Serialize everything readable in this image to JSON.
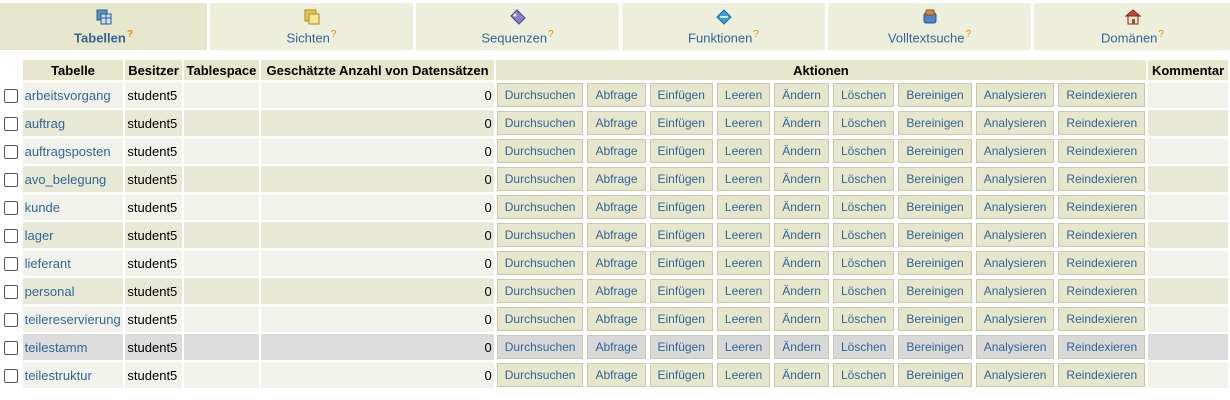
{
  "tabs": [
    {
      "label": "Tabellen",
      "help": "?",
      "icon": "tables-icon",
      "active": true
    },
    {
      "label": "Sichten",
      "help": "?",
      "icon": "views-icon",
      "active": false
    },
    {
      "label": "Sequenzen",
      "help": "?",
      "icon": "sequences-icon",
      "active": false
    },
    {
      "label": "Funktionen",
      "help": "?",
      "icon": "functions-icon",
      "active": false
    },
    {
      "label": "Volltextsuche",
      "help": "?",
      "icon": "fulltext-search-icon",
      "active": false
    },
    {
      "label": "Domänen",
      "help": "?",
      "icon": "domains-icon",
      "active": false
    }
  ],
  "table": {
    "headers": {
      "table": "Tabelle",
      "owner": "Besitzer",
      "tablespace": "Tablespace",
      "estimated_rows": "Geschätzte Anzahl von Datensätzen",
      "actions": "Aktionen",
      "comment": "Kommentar"
    },
    "actions": [
      "Durchsuchen",
      "Abfrage",
      "Einfügen",
      "Leeren",
      "Ändern",
      "Löschen",
      "Bereinigen",
      "Analysieren",
      "Reindexieren"
    ],
    "rows": [
      {
        "name": "arbeitsvorgang",
        "owner": "student5",
        "tablespace": "",
        "count": "0",
        "comment": ""
      },
      {
        "name": "auftrag",
        "owner": "student5",
        "tablespace": "",
        "count": "0",
        "comment": ""
      },
      {
        "name": "auftragsposten",
        "owner": "student5",
        "tablespace": "",
        "count": "0",
        "comment": ""
      },
      {
        "name": "avo_belegung",
        "owner": "student5",
        "tablespace": "",
        "count": "0",
        "comment": ""
      },
      {
        "name": "kunde",
        "owner": "student5",
        "tablespace": "",
        "count": "0",
        "comment": ""
      },
      {
        "name": "lager",
        "owner": "student5",
        "tablespace": "",
        "count": "0",
        "comment": ""
      },
      {
        "name": "lieferant",
        "owner": "student5",
        "tablespace": "",
        "count": "0",
        "comment": ""
      },
      {
        "name": "personal",
        "owner": "student5",
        "tablespace": "",
        "count": "0",
        "comment": ""
      },
      {
        "name": "teilereservierung",
        "owner": "student5",
        "tablespace": "",
        "count": "0",
        "comment": ""
      },
      {
        "name": "teilestamm",
        "owner": "student5",
        "tablespace": "",
        "count": "0",
        "comment": "",
        "highlighted": true
      },
      {
        "name": "teilestruktur",
        "owner": "student5",
        "tablespace": "",
        "count": "0",
        "comment": ""
      }
    ]
  },
  "colors": {
    "link": "#336699",
    "tab_bg": "#eeeedd",
    "header_bg": "#e6e6cc",
    "help_mark": "#e09000"
  }
}
